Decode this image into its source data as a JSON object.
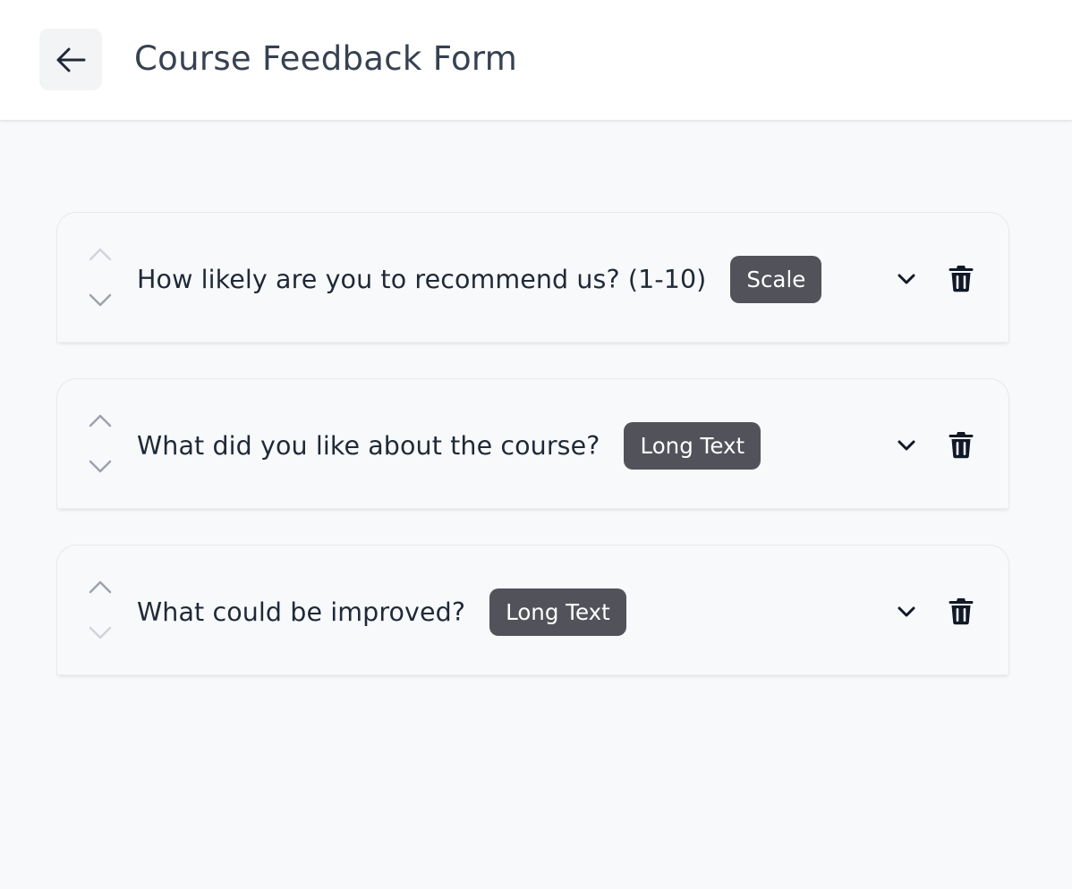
{
  "header": {
    "title": "Course Feedback Form",
    "back_icon": "arrow-left-icon"
  },
  "questions": [
    {
      "text": "How likely are you to recommend us? (1-10)",
      "type": "Scale",
      "move_up_enabled": false,
      "move_down_enabled": true
    },
    {
      "text": "What did you like about the course?",
      "type": "Long Text",
      "move_up_enabled": true,
      "move_down_enabled": true
    },
    {
      "text": "What could be improved?",
      "type": "Long Text",
      "move_up_enabled": true,
      "move_down_enabled": false
    }
  ],
  "icons": {
    "move_up": "chevron-up-icon",
    "move_down": "chevron-down-icon",
    "expand": "chevron-down-icon",
    "delete": "trash-icon"
  },
  "colors": {
    "badge_bg": "#52525b",
    "arrow_enabled": "#9ca3af",
    "arrow_disabled": "#d1d5db",
    "page_bg": "#f8f9fb"
  }
}
